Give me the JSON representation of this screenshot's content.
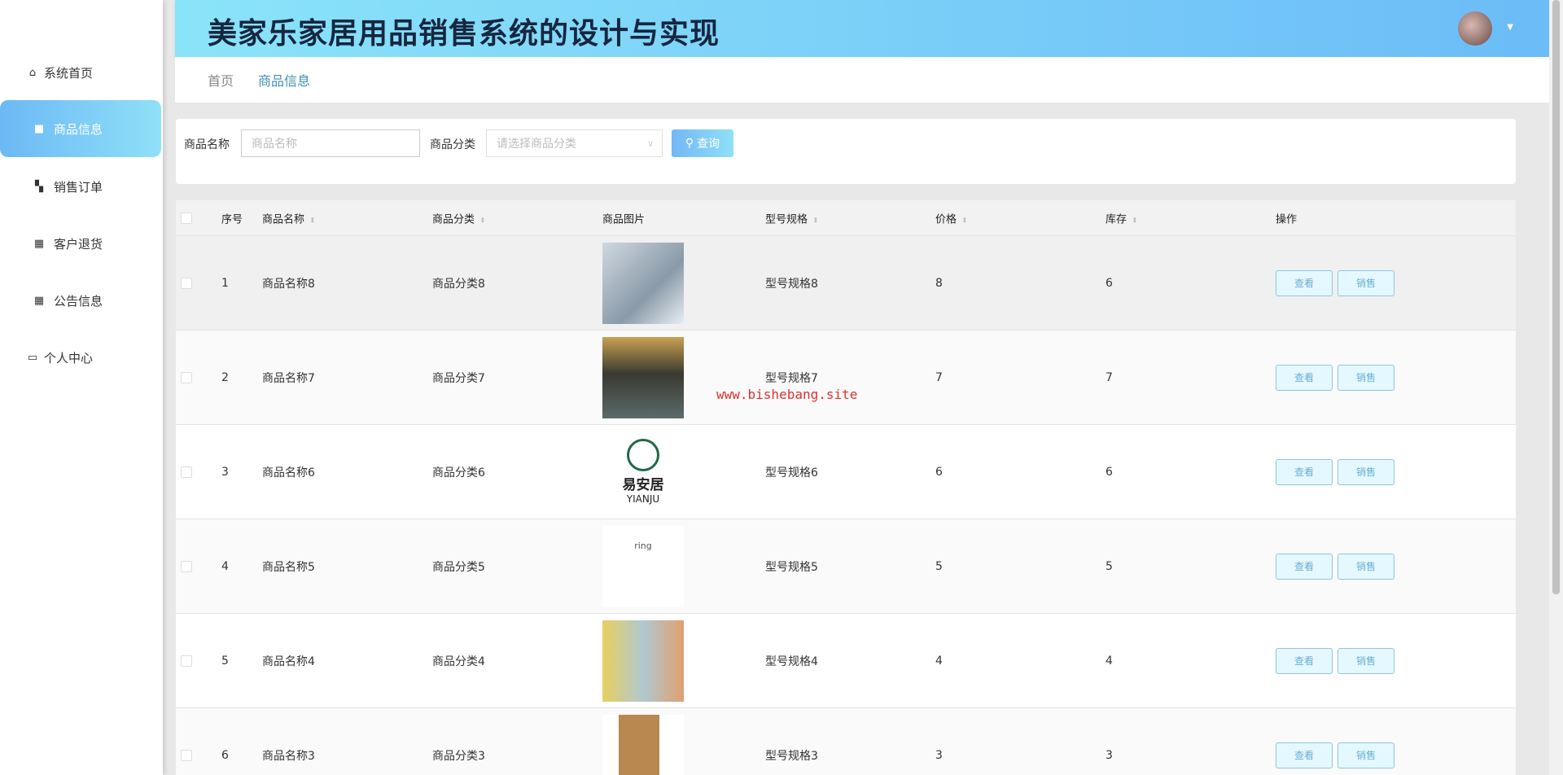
{
  "header": {
    "title": "美家乐家居用品销售系统的设计与实现"
  },
  "sidebar": {
    "items": [
      {
        "label": "系统首页",
        "icon": "home-icon"
      },
      {
        "label": "商品信息",
        "icon": "briefcase-icon",
        "active": true
      },
      {
        "label": "销售订单",
        "icon": "ticket-icon"
      },
      {
        "label": "客户退货",
        "icon": "grid-icon"
      },
      {
        "label": "公告信息",
        "icon": "grid-icon"
      },
      {
        "label": "个人中心",
        "icon": "card-icon"
      }
    ]
  },
  "breadcrumb": [
    "首页",
    "商品信息"
  ],
  "search": {
    "name_label": "商品名称",
    "name_placeholder": "商品名称",
    "category_label": "商品分类",
    "category_placeholder": "请选择商品分类",
    "query_button": "查询"
  },
  "table": {
    "columns": [
      "序号",
      "商品名称",
      "商品分类",
      "商品图片",
      "型号规格",
      "价格",
      "库存",
      "操作"
    ],
    "view_label": "查看",
    "sell_label": "销售",
    "rows": [
      {
        "no": "1",
        "name": "商品名称8",
        "category": "商品分类8",
        "spec": "型号规格8",
        "price": "8",
        "stock": "6"
      },
      {
        "no": "2",
        "name": "商品名称7",
        "category": "商品分类7",
        "spec": "型号规格7",
        "price": "7",
        "stock": "7"
      },
      {
        "no": "3",
        "name": "商品名称6",
        "category": "商品分类6",
        "spec": "型号规格6",
        "price": "6",
        "stock": "6"
      },
      {
        "no": "4",
        "name": "商品名称5",
        "category": "商品分类5",
        "spec": "型号规格5",
        "price": "5",
        "stock": "5"
      },
      {
        "no": "5",
        "name": "商品名称4",
        "category": "商品分类4",
        "spec": "型号规格4",
        "price": "4",
        "stock": "4"
      },
      {
        "no": "6",
        "name": "商品名称3",
        "category": "商品分类3",
        "spec": "型号规格3",
        "price": "3",
        "stock": "3"
      }
    ]
  },
  "logo_text": {
    "cn": "易安居",
    "en": "YIANJU",
    "ring": "ring"
  },
  "watermark": "www.bishebang.site"
}
